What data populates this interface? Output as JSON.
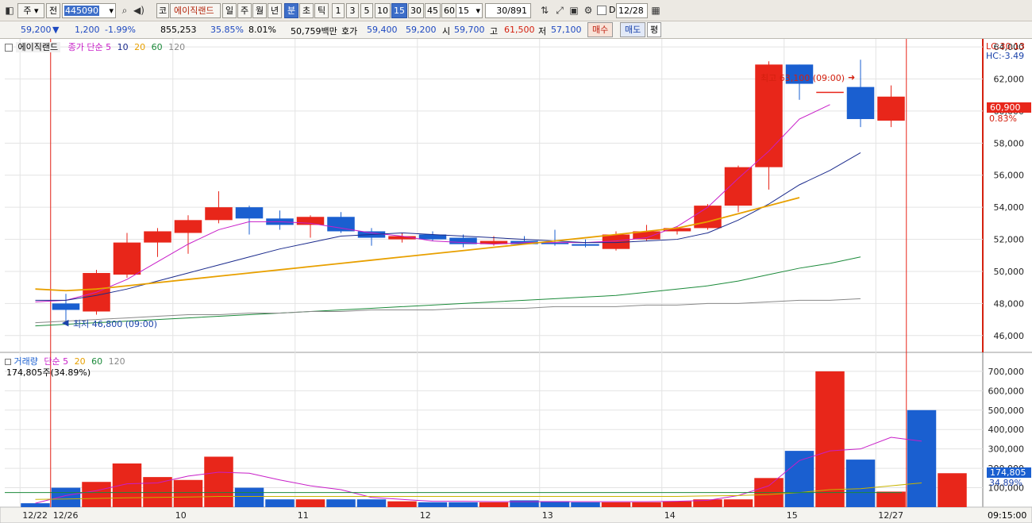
{
  "toolbar": {
    "market": "주",
    "type": "전",
    "code": "445090",
    "symbol_prefix": "코",
    "name": "에이직랜드",
    "periods": [
      "일",
      "주",
      "월",
      "년",
      "분",
      "초",
      "틱"
    ],
    "active_period": "분",
    "minutes": [
      "1",
      "3",
      "5",
      "10",
      "15",
      "30",
      "45",
      "60"
    ],
    "active_minute": "15",
    "minute_select": "15",
    "count": "30",
    "total": "/891",
    "date_flag": "D",
    "date": "12/28"
  },
  "quote": {
    "price": "59,200",
    "arrow": "▼",
    "change": "1,200",
    "change_pct": "-1.99%",
    "volume": "855,253",
    "vol_ratio": "35.85%",
    "turnover_pct": "8.01%",
    "amount": "50,759백만",
    "ask_label": "호가",
    "ask": "59,400",
    "bid": "59,200",
    "open_label": "시",
    "open": "59,700",
    "high_label": "고",
    "high": "61,500",
    "low_label": "저",
    "low": "57,100",
    "buy_label": "매수",
    "sell_label": "매도",
    "avg_label": "평"
  },
  "legend": {
    "stock_name": "에이직랜드",
    "price_ma_label": "종가 단순 5",
    "ma_periods": [
      "10",
      "20",
      "60",
      "120"
    ],
    "ma_colors": [
      "#c81ec8",
      "#1a2a8c",
      "#e8a000",
      "#1b8a3a",
      "#888888"
    ],
    "volume_label": "거래량",
    "volume_ma_label": "단순 5",
    "volume_current": "174,805주(34.89%)"
  },
  "right_panel": {
    "lc": "LC:30.13",
    "hc": "HC:-3.49",
    "last_price": "60,900",
    "last_pct": "0.83%",
    "last_volume": "174,805",
    "last_volume_pct": "34.89%",
    "time": "09:15:00"
  },
  "colors": {
    "up": "#e8261a",
    "down": "#1a5fd0"
  },
  "chart_data": {
    "type": "candlestick",
    "price_ylim": [
      45000,
      64500
    ],
    "price_ticks": [
      "46,000",
      "48,000",
      "50,000",
      "52,000",
      "54,000",
      "56,000",
      "58,000",
      "60,000",
      "62,000",
      "64,000"
    ],
    "volume_ylim": [
      0,
      720000
    ],
    "volume_ticks": [
      "100,000",
      "200,000",
      "300,000",
      "400,000",
      "500,000",
      "600,000",
      "700,000"
    ],
    "x_labels": [
      "12/22",
      "12/26",
      "10",
      "11",
      "12",
      "13",
      "14",
      "15",
      "12/27"
    ],
    "candles": [
      {
        "o": 48000,
        "h": 48600,
        "l": 46800,
        "c": 47600
      },
      {
        "o": 47500,
        "h": 50100,
        "l": 47300,
        "c": 49900
      },
      {
        "o": 49800,
        "h": 52400,
        "l": 49600,
        "c": 51800
      },
      {
        "o": 51800,
        "h": 52700,
        "l": 50900,
        "c": 52500
      },
      {
        "o": 52400,
        "h": 53500,
        "l": 51100,
        "c": 53200
      },
      {
        "o": 53200,
        "h": 55000,
        "l": 53000,
        "c": 54000
      },
      {
        "o": 54000,
        "h": 54100,
        "l": 52300,
        "c": 53300
      },
      {
        "o": 53300,
        "h": 53800,
        "l": 52600,
        "c": 52900
      },
      {
        "o": 52900,
        "h": 53500,
        "l": 52100,
        "c": 53400
      },
      {
        "o": 53400,
        "h": 53700,
        "l": 52400,
        "c": 52500
      },
      {
        "o": 52500,
        "h": 52700,
        "l": 51600,
        "c": 52100
      },
      {
        "o": 52000,
        "h": 52400,
        "l": 51800,
        "c": 52200
      },
      {
        "o": 52300,
        "h": 52500,
        "l": 51900,
        "c": 52000
      },
      {
        "o": 52100,
        "h": 52300,
        "l": 51500,
        "c": 51700
      },
      {
        "o": 51700,
        "h": 52200,
        "l": 51600,
        "c": 51900
      },
      {
        "o": 51900,
        "h": 52200,
        "l": 51700,
        "c": 51700
      },
      {
        "o": 51800,
        "h": 52600,
        "l": 51600,
        "c": 51700
      },
      {
        "o": 51700,
        "h": 52000,
        "l": 51500,
        "c": 51600
      },
      {
        "o": 51400,
        "h": 52500,
        "l": 51300,
        "c": 52300
      },
      {
        "o": 52000,
        "h": 52900,
        "l": 51900,
        "c": 52500
      },
      {
        "o": 52500,
        "h": 52800,
        "l": 52300,
        "c": 52700
      },
      {
        "o": 52700,
        "h": 54200,
        "l": 52600,
        "c": 54100
      },
      {
        "o": 54100,
        "h": 56600,
        "l": 53700,
        "c": 56500
      },
      {
        "o": 56500,
        "h": 63100,
        "l": 55100,
        "c": 62900
      },
      {
        "o": 62900,
        "h": 62900,
        "l": 60700,
        "c": 61700
      },
      {
        "o": 61200,
        "h": 61200,
        "l": 61200,
        "c": 61200
      },
      {
        "o": 61500,
        "h": 63200,
        "l": 59000,
        "c": 59500
      },
      {
        "o": 59400,
        "h": 61600,
        "l": 59000,
        "c": 60900
      }
    ],
    "volumes": [
      20000,
      100000,
      130000,
      225000,
      155000,
      140000,
      260000,
      100000,
      40000,
      40000,
      40000,
      40000,
      30000,
      25000,
      25000,
      25000,
      35000,
      30000,
      25000,
      25000,
      25000,
      30000,
      40000,
      40000,
      150000,
      290000,
      700000,
      245000,
      80000,
      500000,
      174805
    ],
    "ma_series": [
      {
        "name": "5",
        "values": [
          48100,
          48200,
          48700,
          49500,
          50600,
          51700,
          52600,
          53100,
          53100,
          53000,
          52700,
          52400,
          52200,
          51900,
          51800,
          51700,
          51800,
          51800,
          51800,
          51900,
          52100,
          52800,
          54000,
          55800,
          57500,
          59500,
          60400
        ]
      },
      {
        "name": "10",
        "values": [
          48200,
          48200,
          48500,
          48900,
          49400,
          49900,
          50400,
          50900,
          51400,
          51800,
          52200,
          52300,
          52400,
          52300,
          52200,
          52100,
          52000,
          51900,
          51800,
          51800,
          51900,
          52000,
          52400,
          53200,
          54200,
          55400,
          56300,
          57400
        ]
      },
      {
        "name": "20",
        "values": [
          48900,
          48800,
          48900,
          49100,
          49300,
          49500,
          49700,
          49900,
          50100,
          50300,
          50500,
          50700,
          50900,
          51100,
          51300,
          51500,
          51700,
          51900,
          52100,
          52300,
          52500,
          52700,
          53100,
          53600,
          54100,
          54600
        ]
      },
      {
        "name": "60",
        "values": [
          46600,
          46700,
          46800,
          46900,
          47000,
          47100,
          47200,
          47300,
          47400,
          47500,
          47600,
          47700,
          47800,
          47900,
          48000,
          48100,
          48200,
          48300,
          48400,
          48500,
          48700,
          48900,
          49100,
          49400,
          49800,
          50200,
          50500,
          50900
        ]
      },
      {
        "name": "120",
        "values": [
          46800,
          46900,
          47000,
          47100,
          47200,
          47300,
          47300,
          47400,
          47400,
          47500,
          47500,
          47600,
          47600,
          47600,
          47700,
          47700,
          47700,
          47800,
          47800,
          47800,
          47900,
          47900,
          48000,
          48000,
          48100,
          48200,
          48200,
          48300
        ]
      }
    ],
    "volume_ma_series": [
      {
        "name": "5",
        "values": [
          20000,
          60000,
          85000,
          120000,
          125000,
          160000,
          180000,
          175000,
          140000,
          110000,
          90000,
          50000,
          40000,
          30000,
          30000,
          28000,
          28000,
          28000,
          28000,
          28000,
          28000,
          30000,
          35000,
          60000,
          110000,
          240000,
          290000,
          300000,
          360000,
          340000
        ]
      },
      {
        "name": "20",
        "values": [
          40000,
          42000,
          45000,
          48000,
          50000,
          52000,
          55000,
          55000,
          55000,
          55000,
          55000,
          55000,
          55000,
          55000,
          55000,
          55000,
          55000,
          55000,
          55000,
          55000,
          55000,
          55000,
          58000,
          60000,
          65000,
          75000,
          90000,
          95000,
          110000,
          125000
        ]
      }
    ],
    "annotations": {
      "high": "최고 63,100 (09:00)",
      "low": "최저 46,800 (09:00)"
    }
  }
}
